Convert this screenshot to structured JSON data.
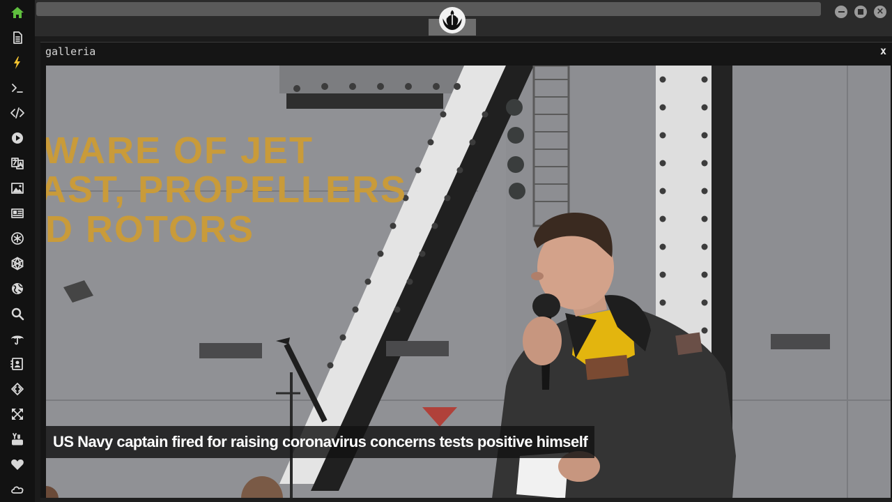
{
  "sidebar": {
    "items": [
      {
        "name": "home-icon"
      },
      {
        "name": "document-icon"
      },
      {
        "name": "lightning-icon"
      },
      {
        "name": "terminal-icon"
      },
      {
        "name": "code-icon"
      },
      {
        "name": "play-icon"
      },
      {
        "name": "translate-icon"
      },
      {
        "name": "image-icon"
      },
      {
        "name": "newspaper-icon"
      },
      {
        "name": "asterisk-icon"
      },
      {
        "name": "hexagon-icon"
      },
      {
        "name": "globe-icon"
      },
      {
        "name": "search-icon"
      },
      {
        "name": "umbrella-icon"
      },
      {
        "name": "contact-icon"
      },
      {
        "name": "diamond-code-icon"
      },
      {
        "name": "expand-icon"
      },
      {
        "name": "youtube-icon"
      },
      {
        "name": "heart-icon"
      },
      {
        "name": "cloud-icon"
      }
    ],
    "active_color": "#5fbf3e",
    "highlight_color": "#f2c230"
  },
  "topbar": {
    "logo": "rebel-alliance-icon",
    "window_controls": [
      "minimize-icon",
      "maximize-icon",
      "close-icon"
    ]
  },
  "gallery": {
    "title": "galleria",
    "close_label": "x",
    "photo": {
      "sign_lines": [
        "WARE OF JET",
        "AST, PROPELLERS",
        "ID ROTORS"
      ]
    },
    "caption": "US Navy captain fired for raising coronavirus concerns tests positive himself"
  }
}
